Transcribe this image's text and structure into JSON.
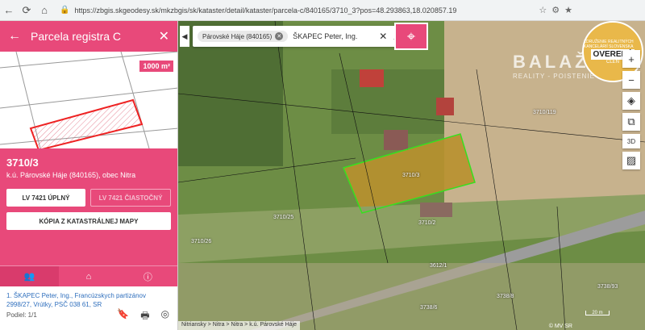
{
  "browser": {
    "url": "https://zbgis.skgeodesy.sk/mkzbgis/sk/kataster/detail/kataster/parcela-c/840165/3710_3?pos=48.293863,18.020857.19"
  },
  "panel": {
    "title": "Parcela registra C",
    "area_badge": "1000 m²",
    "parcel_number": "3710/3",
    "cadastral_area": "k.ú. Párovské Háje (840165), obec Nitra",
    "buttons": {
      "lv_full": "LV 7421 ÚPLNÝ",
      "lv_partial": "LV 7421 ČIASTOČNÝ",
      "copy_map": "KÓPIA Z KATASTRÁLNEJ MAPY"
    },
    "tabs": [
      "owners",
      "home",
      "info"
    ],
    "owner": {
      "name": "1. ŠKAPEC Peter, Ing., Francúzskych partizánov 2998/27, Vrútky, PSČ 038 61, SR",
      "share": "Podiel: 1/1"
    }
  },
  "map": {
    "search_chip": "Párovské Háje (840165)",
    "search_text": "ŠKAPEC Peter, Ing.",
    "watermark_title": "BALAŽI",
    "watermark_sub": "REALITY - POISTENIE - ÚVERY",
    "badge_main": "OVERENÝ",
    "badge_member": "ČLEN",
    "badge_ring": "ZDRUŽENIE REALITNÝCH KANCELÁRIÍ SLOVENSKA",
    "tool_3d": "3D",
    "scale": "20 m",
    "attribution": "Nitriansky > Nitra > Nitra > k.ú. Párovské Háje",
    "copyright": "© MV SR",
    "labels": {
      "l1": "3710/119",
      "l2": "3710/3",
      "l3": "3710/25",
      "l4": "3710/26",
      "l5": "3612/1",
      "l6": "3738/6",
      "l7": "3738/8",
      "l8": "3738/93",
      "l9": "3710/2"
    }
  },
  "colors": {
    "accent": "#e8497a",
    "parcel_outline": "#36e01f"
  }
}
